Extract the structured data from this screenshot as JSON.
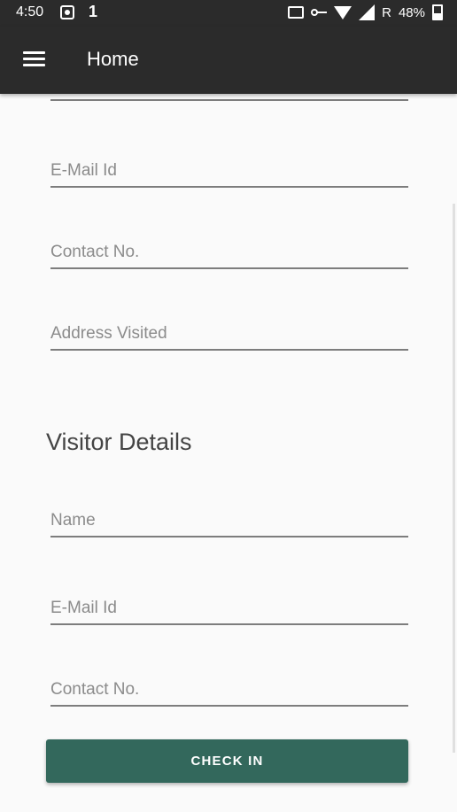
{
  "status_bar": {
    "time": "4:50",
    "notification": "1",
    "network": "R",
    "battery": "48%"
  },
  "app_bar": {
    "title": "Home"
  },
  "form": {
    "host_fields": [
      {
        "placeholder": "E-Mail Id"
      },
      {
        "placeholder": "Contact No."
      },
      {
        "placeholder": "Address Visited"
      }
    ],
    "visitor_section_title": "Visitor Details",
    "visitor_fields": [
      {
        "placeholder": "Name"
      },
      {
        "placeholder": "E-Mail Id"
      },
      {
        "placeholder": "Contact No."
      }
    ],
    "submit_label": "CHECK IN",
    "accent_color": "#33685c"
  }
}
